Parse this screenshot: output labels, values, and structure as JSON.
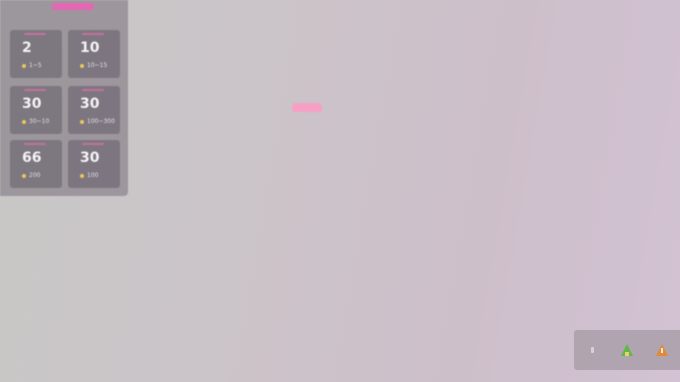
{
  "panel": {
    "title": "",
    "tiles": [
      {
        "value": "2",
        "sub": "1~5"
      },
      {
        "value": "10",
        "sub": "10~15"
      },
      {
        "value": "30",
        "sub": "30~10"
      },
      {
        "value": "30",
        "sub": "100~300"
      },
      {
        "value": "66",
        "sub": "200"
      },
      {
        "value": "30",
        "sub": "100"
      }
    ]
  },
  "toast": {
    "text": ""
  },
  "toolbar": {
    "buttons": [
      {
        "icon": "more-icon"
      },
      {
        "icon": "triangle-up-icon",
        "color": "#5fb84a"
      },
      {
        "icon": "triangle-warning-icon",
        "color": "#e08a3a"
      }
    ]
  },
  "colors": {
    "accent": "#f05fb8",
    "tile_dot": "#e8c85a",
    "background": "#cbc4c8"
  }
}
